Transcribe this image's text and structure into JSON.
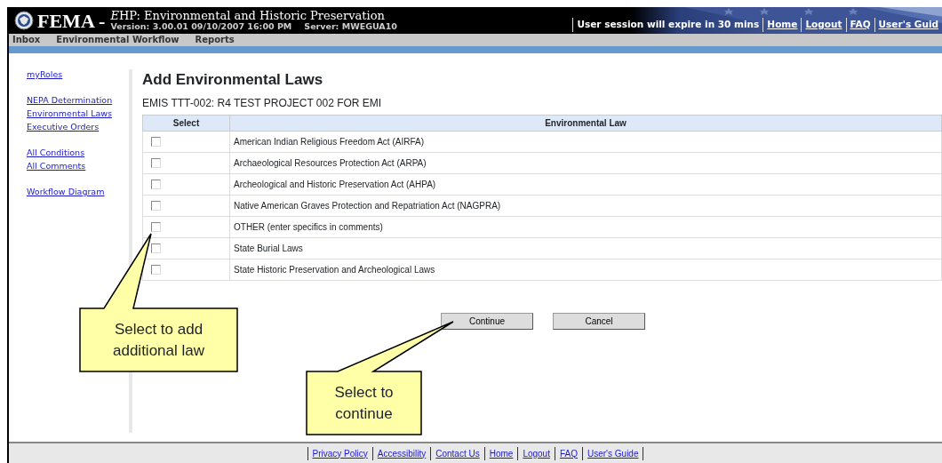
{
  "header": {
    "agency": "FEMA -",
    "app_title": "EHP: Environmental and Historic Preservation",
    "version": "Version: 3.00.01 09/10/2007 16:00 PM",
    "server": "Server: MWEGUA10",
    "session": "User session will expire in 30 mins",
    "links": [
      "Home",
      "Logout",
      "FAQ",
      "User's Guid"
    ]
  },
  "menu": [
    "Inbox",
    "Environmental Workflow",
    "Reports"
  ],
  "sidebar": {
    "groups": [
      [
        "myRoles"
      ],
      [
        "NEPA Determination",
        "Environmental Laws",
        "Executive Orders"
      ],
      [
        "All Conditions",
        "All Comments"
      ],
      [
        "Workflow Diagram"
      ]
    ]
  },
  "page_title": "Add Environmental Laws",
  "project": "EMIS TTT-002: R4 TEST PROJECT 002 FOR EMI",
  "table": {
    "columns": [
      "Select",
      "Environmental Law"
    ],
    "rows": [
      {
        "law": "American Indian Religious Freedom Act (AIRFA)",
        "checked": false
      },
      {
        "law": "Archaeological Resources Protection Act (ARPA)",
        "checked": false
      },
      {
        "law": "Archeological and Historic Preservation Act (AHPA)",
        "checked": false
      },
      {
        "law": "Native American Graves Protection and Repatriation Act (NAGPRA)",
        "checked": false
      },
      {
        "law": "OTHER (enter specifics in comments)",
        "checked": false
      },
      {
        "law": "State Burial Laws",
        "checked": false
      },
      {
        "law": "State Historic Preservation and Archeological Laws",
        "checked": false
      }
    ]
  },
  "buttons": [
    "Continue",
    "Cancel"
  ],
  "callouts": [
    {
      "text": "Select to add additional law"
    },
    {
      "text": "Select to continue"
    }
  ],
  "footer": {
    "links": [
      "Privacy Policy",
      "Accessibility",
      "Contact Us",
      "Home",
      "Logout",
      "FAQ",
      "User's Guide"
    ]
  }
}
